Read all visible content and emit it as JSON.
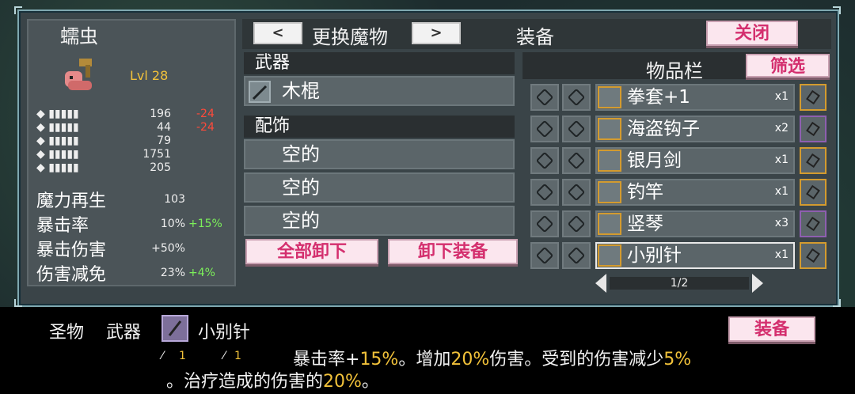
{
  "monster": {
    "name": "蠕虫",
    "level": "Lvl 28",
    "stats": [
      {
        "icon": "sword-icon",
        "value": "196",
        "delta": "-24"
      },
      {
        "icon": "wand-icon",
        "value": "44",
        "delta": "-24"
      },
      {
        "icon": "shield-icon",
        "value": "79",
        "delta": ""
      },
      {
        "icon": "heart-icon",
        "value": "1751",
        "delta": ""
      },
      {
        "icon": "potion-icon",
        "value": "205",
        "delta": ""
      }
    ],
    "big_stats": [
      {
        "label": "魔力再生",
        "value": "103",
        "delta": ""
      },
      {
        "label": "暴击率",
        "value": "10%",
        "delta": "+15%"
      },
      {
        "label": "暴击伤害",
        "value": "+50%",
        "delta": ""
      },
      {
        "label": "伤害减免",
        "value": "23%",
        "delta": "+4%"
      }
    ]
  },
  "header": {
    "prev": "<",
    "change_monster": "更换魔物",
    "next": ">",
    "equipment": "装备",
    "close": "关闭"
  },
  "equip": {
    "weapon_header": "武器",
    "weapon_item": "木棍",
    "accessory_header": "配饰",
    "accessory_slots": [
      "空的",
      "空的",
      "空的"
    ],
    "unequip_all": "全部卸下",
    "unequip": "卸下装备"
  },
  "inventory": {
    "title": "物品栏",
    "filter": "筛选",
    "items": [
      {
        "name": "拳套+1",
        "count": "x1"
      },
      {
        "name": "海盗钩子",
        "count": "x2"
      },
      {
        "name": "银月剑",
        "count": "x1"
      },
      {
        "name": "钓竿",
        "count": "x1"
      },
      {
        "name": "竖琴",
        "count": "x3"
      },
      {
        "name": "小别针",
        "count": "x1"
      }
    ],
    "page": "1/2"
  },
  "detail": {
    "rarity": "圣物",
    "type": "武器",
    "name": "小别针",
    "stat1": "1",
    "stat2": "1",
    "desc_parts": [
      {
        "t": "暴击率+",
        "c": "w"
      },
      {
        "t": "15%",
        "c": "y"
      },
      {
        "t": "。增加",
        "c": "w"
      },
      {
        "t": "20%",
        "c": "y"
      },
      {
        "t": "伤害。受到的伤害减少",
        "c": "w"
      },
      {
        "t": "5%",
        "c": "y"
      }
    ],
    "desc_line2": [
      {
        "t": "。治疗造成的伤害的",
        "c": "w"
      },
      {
        "t": "20%",
        "c": "y"
      },
      {
        "t": "。",
        "c": "w"
      }
    ],
    "equip_button": "装备"
  },
  "colors": {
    "pink_button_text": "#d42f6e",
    "highlight_yellow": "#f2c23a",
    "negative_red": "#ff4a3a",
    "positive_green": "#7cf05a"
  }
}
